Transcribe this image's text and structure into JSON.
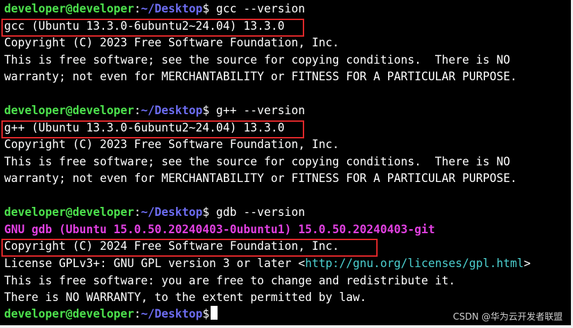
{
  "prompt": {
    "user": "developer@developer",
    "colon": ":",
    "path": "~/Desktop",
    "symbol": "$"
  },
  "commands": {
    "gcc": " gcc --version",
    "gpp": " g++ --version",
    "gdb": " gdb --version"
  },
  "gcc_output": {
    "version": "gcc (Ubuntu 13.3.0-6ubuntu2~24.04) 13.3.0",
    "copyright": "Copyright (C) 2023 Free Software Foundation, Inc.",
    "license1": "This is free software; see the source for copying conditions.  There is NO",
    "license2": "warranty; not even for MERCHANTABILITY or FITNESS FOR A PARTICULAR PURPOSE."
  },
  "gpp_output": {
    "version": "g++ (Ubuntu 13.3.0-6ubuntu2~24.04) 13.3.0",
    "copyright": "Copyright (C) 2023 Free Software Foundation, Inc.",
    "license1": "This is free software; see the source for copying conditions.  There is NO",
    "license2": "warranty; not even for MERCHANTABILITY or FITNESS FOR A PARTICULAR PURPOSE."
  },
  "gdb_output": {
    "version": "GNU gdb (Ubuntu 15.0.50.20240403-0ubuntu1) 15.0.50.20240403-git",
    "copyright": "Copyright (C) 2024 Free Software Foundation, Inc.",
    "license_prefix": "License GPLv3+: GNU GPL version 3 or later <",
    "license_url": "http://gnu.org/licenses/gpl.html",
    "license_suffix": ">",
    "free": "This is free software: you are free to change and redistribute it.",
    "warranty": "There is NO WARRANTY, to the extent permitted by law."
  },
  "watermark": "CSDN @华为云开发者联盟",
  "colors": {
    "background": "#000000",
    "user": "#4ce04c",
    "path": "#6c6cf0",
    "gdb_header": "#e040e0",
    "url": "#4cd0d0",
    "highlight": "#e0282a"
  }
}
